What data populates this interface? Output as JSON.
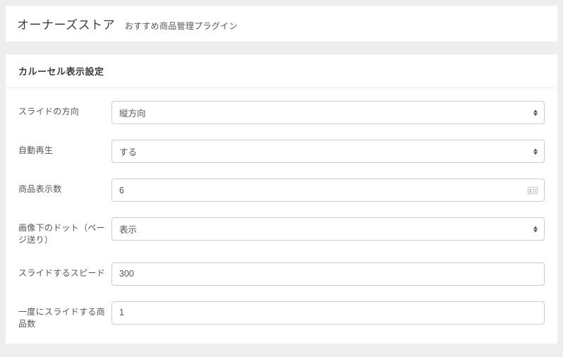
{
  "header": {
    "title": "オーナーズストア",
    "subtitle": "おすすめ商品管理プラグイン"
  },
  "panel": {
    "heading": "カルーセル表示設定"
  },
  "form": {
    "slide_direction": {
      "label": "スライドの方向",
      "value": "縦方向"
    },
    "autoplay": {
      "label": "自動再生",
      "value": "する"
    },
    "item_count": {
      "label": "商品表示数",
      "value": "6"
    },
    "dots": {
      "label": "画像下のドット（ページ送り）",
      "value": "表示"
    },
    "speed": {
      "label": "スライドするスピード",
      "value": "300"
    },
    "slides_to_scroll": {
      "label": "一度にスライドする商品数",
      "value": "1"
    }
  }
}
